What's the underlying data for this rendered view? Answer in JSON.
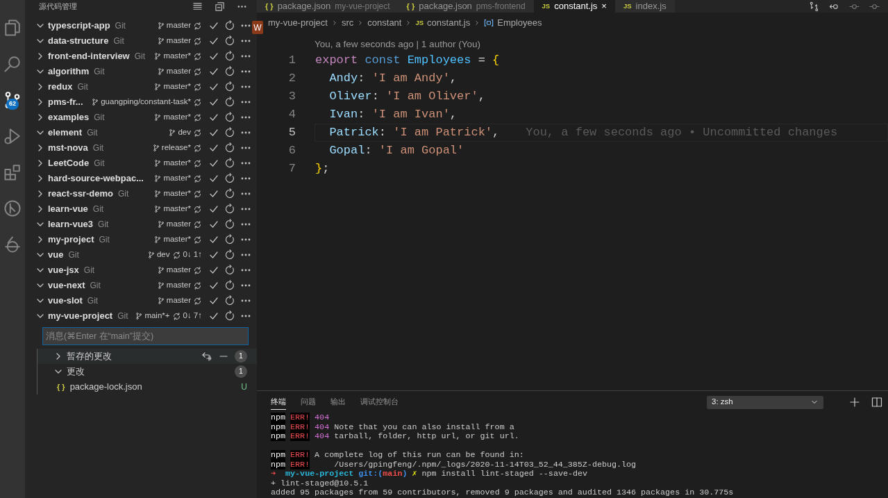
{
  "activity_bar": {
    "items": [
      {
        "kind": "files",
        "selected": false
      },
      {
        "kind": "search",
        "selected": false
      },
      {
        "kind": "scm",
        "selected": true,
        "badge": "62"
      },
      {
        "kind": "debug",
        "selected": false
      },
      {
        "kind": "extensions",
        "selected": false
      },
      {
        "kind": "graph",
        "selected": false
      },
      {
        "kind": "timeline",
        "selected": false
      }
    ]
  },
  "sidebar": {
    "title": "源代码管理",
    "avatar": "W",
    "repos": [
      {
        "name": "typescript-app",
        "provider": "Git",
        "expanded": true,
        "branch": "master"
      },
      {
        "name": "data-structure",
        "provider": "Git",
        "expanded": true,
        "branch": "master"
      },
      {
        "name": "front-end-interview",
        "provider": "Git",
        "expanded": false,
        "branch": "master*"
      },
      {
        "name": "algorithm",
        "provider": "Git",
        "expanded": true,
        "branch": "master"
      },
      {
        "name": "redux",
        "provider": "Git",
        "expanded": false,
        "branch": "master*"
      },
      {
        "name": "pms-fr...",
        "expanded": false,
        "branch": "guangping/constant-task*"
      },
      {
        "name": "examples",
        "provider": "Git",
        "expanded": false,
        "branch": "master*"
      },
      {
        "name": "element",
        "provider": "Git",
        "expanded": true,
        "branch": "dev"
      },
      {
        "name": "mst-nova",
        "provider": "Git",
        "expanded": false,
        "branch": "release*"
      },
      {
        "name": "LeetCode",
        "provider": "Git",
        "expanded": false,
        "branch": "master*"
      },
      {
        "name": "hard-source-webpac...",
        "expanded": false,
        "branch": "master*"
      },
      {
        "name": "react-ssr-demo",
        "provider": "Git",
        "expanded": false,
        "branch": "master*"
      },
      {
        "name": "learn-vue",
        "provider": "Git",
        "expanded": false,
        "branch": "master*"
      },
      {
        "name": "learn-vue3",
        "provider": "Git",
        "expanded": true,
        "branch": "master"
      },
      {
        "name": "my-project",
        "provider": "Git",
        "expanded": false,
        "branch": "master*"
      },
      {
        "name": "vue",
        "provider": "Git",
        "expanded": true,
        "branch": "dev",
        "sync": "0↓ 1↑"
      },
      {
        "name": "vue-jsx",
        "provider": "Git",
        "expanded": true,
        "branch": "master"
      },
      {
        "name": "vue-next",
        "provider": "Git",
        "expanded": true,
        "branch": "master"
      },
      {
        "name": "vue-slot",
        "provider": "Git",
        "expanded": true,
        "branch": "master"
      },
      {
        "name": "my-vue-project",
        "provider": "Git",
        "expanded": true,
        "branch": "main*+",
        "sync": "0↓ 7↑"
      }
    ],
    "commit_input": {
      "placeholder": "消息(⌘Enter 在“main”提交)"
    },
    "groups": [
      {
        "label": "暂存的更改",
        "expanded": false,
        "count": "1",
        "kind": "staged"
      },
      {
        "label": "更改",
        "expanded": true,
        "count": "1",
        "kind": "changes",
        "files": [
          {
            "icon": "{ }",
            "name": "package-lock.json",
            "status": "U"
          }
        ]
      }
    ]
  },
  "editor": {
    "tabs": [
      {
        "icon": "{ }",
        "kind": "json",
        "label": "package.json",
        "detail": "my-vue-project",
        "selected": false
      },
      {
        "icon": "{ }",
        "kind": "json",
        "label": "package.json",
        "detail": "pms-frontend",
        "selected": false
      },
      {
        "icon": "JS",
        "kind": "js",
        "label": "constant.js",
        "selected": true,
        "close": "×"
      },
      {
        "icon": "JS",
        "kind": "js",
        "label": "index.js",
        "selected": false
      }
    ],
    "breadcrumbs": [
      {
        "label": "my-vue-project"
      },
      {
        "label": "src"
      },
      {
        "label": "constant"
      },
      {
        "label": "constant.js",
        "icon": "JS"
      },
      {
        "label": "Employees",
        "kind": "symbol"
      }
    ],
    "code_lens": "You, a few seconds ago | 1 author (You)",
    "lines": [
      {
        "number": "1",
        "tokens": [
          {
            "text": "export ",
            "kind": "keyword"
          },
          {
            "text": "const ",
            "kind": "storage"
          },
          {
            "text": "Employees",
            "kind": "constant"
          },
          {
            "text": " = ",
            "kind": "punctuation"
          },
          {
            "text": "{",
            "kind": "brace"
          }
        ]
      },
      {
        "number": "2",
        "tokens": [
          {
            "text": "  Andy",
            "kind": "property"
          },
          {
            "text": ": ",
            "kind": "punctuation"
          },
          {
            "text": "'I am Andy'",
            "kind": "string"
          },
          {
            "text": ",",
            "kind": "punctuation"
          }
        ]
      },
      {
        "number": "3",
        "tokens": [
          {
            "text": "  Oliver",
            "kind": "property"
          },
          {
            "text": ": ",
            "kind": "punctuation"
          },
          {
            "text": "'I am Oliver'",
            "kind": "string"
          },
          {
            "text": ",",
            "kind": "punctuation"
          }
        ]
      },
      {
        "number": "4",
        "tokens": [
          {
            "text": "  Ivan",
            "kind": "property"
          },
          {
            "text": ": ",
            "kind": "punctuation"
          },
          {
            "text": "'I am Ivan'",
            "kind": "string"
          },
          {
            "text": ",",
            "kind": "punctuation"
          }
        ]
      },
      {
        "number": "5",
        "current": true,
        "blame": "You, a few seconds ago • Uncommitted changes",
        "tokens": [
          {
            "text": "  Patrick",
            "kind": "property"
          },
          {
            "text": ": ",
            "kind": "punctuation"
          },
          {
            "text": "'I am Patrick'",
            "kind": "string"
          },
          {
            "text": ",",
            "kind": "punctuation"
          }
        ]
      },
      {
        "number": "6",
        "tokens": [
          {
            "text": "  Gopal",
            "kind": "property"
          },
          {
            "text": ": ",
            "kind": "punctuation"
          },
          {
            "text": "'I am Gopal'",
            "kind": "string"
          }
        ]
      },
      {
        "number": "7",
        "tokens": [
          {
            "text": "}",
            "kind": "brace"
          },
          {
            "text": ";",
            "kind": "punctuation"
          }
        ]
      }
    ]
  },
  "panel": {
    "tabs": [
      {
        "label": "终端",
        "selected": true
      },
      {
        "label": "问题",
        "selected": false
      },
      {
        "label": "输出",
        "selected": false
      },
      {
        "label": "调试控制台",
        "selected": false
      }
    ],
    "terminal_select": "3: zsh",
    "lines": [
      {
        "segments": [
          {
            "text": "npm",
            "kind": "npm"
          },
          {
            "text": "ERR!",
            "kind": "err"
          },
          {
            "text": "404",
            "kind": "code"
          }
        ]
      },
      {
        "segments": [
          {
            "text": "npm",
            "kind": "npm"
          },
          {
            "text": "ERR!",
            "kind": "err"
          },
          {
            "text": "404",
            "kind": "code"
          },
          {
            "text": " Note that you can also install from a"
          }
        ]
      },
      {
        "segments": [
          {
            "text": "npm",
            "kind": "npm"
          },
          {
            "text": "ERR!",
            "kind": "err"
          },
          {
            "text": "404",
            "kind": "code"
          },
          {
            "text": " tarball, folder, http url, or git url."
          }
        ]
      },
      {
        "kind": "blank"
      },
      {
        "segments": [
          {
            "text": "npm",
            "kind": "npm"
          },
          {
            "text": "ERR!",
            "kind": "err"
          },
          {
            "text": "A complete log of this run can be found in:"
          }
        ]
      },
      {
        "segments": [
          {
            "text": "npm",
            "kind": "npm"
          },
          {
            "text": "ERR!",
            "kind": "err"
          },
          {
            "text": "    /Users/gpingfeng/.npm/_logs/2020-11-14T03_52_44_385Z-debug.log"
          }
        ]
      },
      {
        "segments": [
          {
            "text": "➜ ",
            "kind": "arrow"
          },
          {
            "text": " my-vue-project ",
            "kind": "dir"
          },
          {
            "text": "git:(",
            "kind": "git"
          },
          {
            "text": "main",
            "kind": "branch"
          },
          {
            "text": ")",
            "kind": "git"
          },
          {
            "text": " ✗ ",
            "kind": "dirty"
          },
          {
            "text": "npm install lint-staged --save-dev"
          }
        ]
      },
      {
        "segments": [
          {
            "text": "+ lint-staged@10.5.1"
          }
        ]
      },
      {
        "segments": [
          {
            "text": "added 95 packages from 59 contributors, removed 9 packages and audited 1346 packages in 30.775s"
          }
        ]
      }
    ]
  }
}
